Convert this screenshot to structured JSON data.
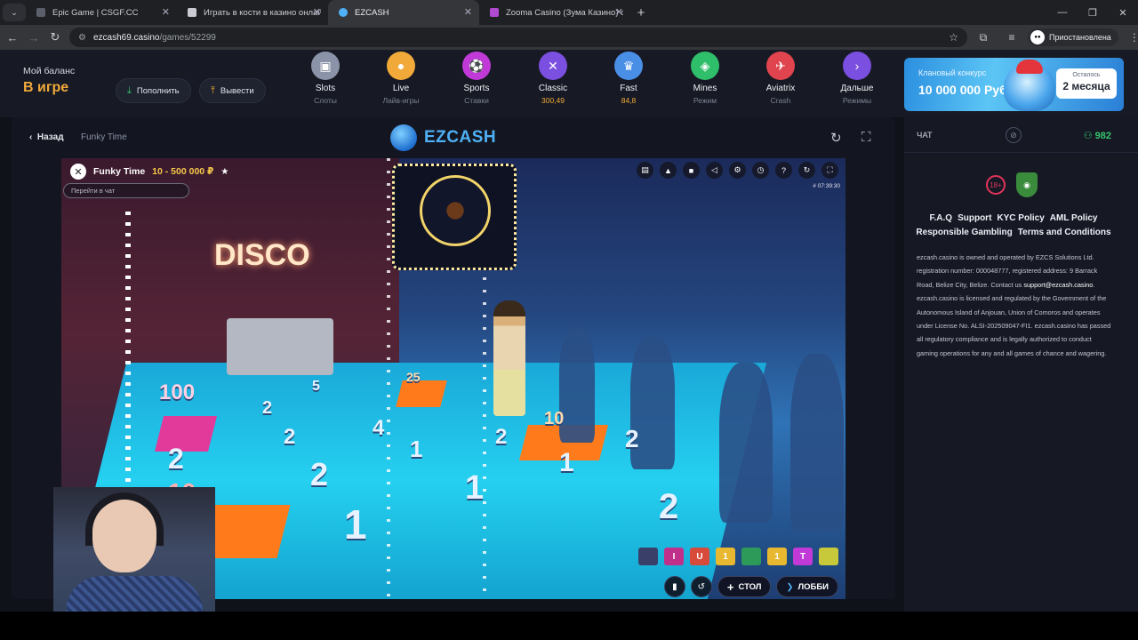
{
  "browser": {
    "tabs": [
      {
        "title": "Epic Game | CSGF.CC",
        "favicon_color": "#5a5f6a",
        "active": false
      },
      {
        "title": "Играть в кости в казино онлайн",
        "favicon_color": "#c9ccd2",
        "active": false
      },
      {
        "title": "EZCASH",
        "favicon_color": "#4fb0f5",
        "active": true
      },
      {
        "title": "Zooma Casino (Зума Казино) о",
        "favicon_color": "#b04ad0",
        "active": false
      }
    ],
    "new_tab": "+",
    "url_host": "ezcash69.casino",
    "url_path": "/games/52299",
    "profile_label": "Приостановлена"
  },
  "header": {
    "balance_title": "Мой баланс",
    "balance_value": "В игре",
    "deposit_label": "Пополнить",
    "withdraw_label": "Вывести",
    "nav": [
      {
        "label": "Slots",
        "sub": "Слоты",
        "color": "#8b93a8",
        "glyph": "▣"
      },
      {
        "label": "Live",
        "sub": "Лайв-игры",
        "color": "#f1a93a",
        "glyph": "●"
      },
      {
        "label": "Sports",
        "sub": "Ставки",
        "color": "#c13ad8",
        "glyph": "⚽"
      },
      {
        "label": "Classic",
        "sub": "300,49",
        "color": "#7b4fe0",
        "glyph": "✕",
        "num": true
      },
      {
        "label": "Fast",
        "sub": "84,8",
        "color": "#4a8fe6",
        "glyph": "♛",
        "num": true
      },
      {
        "label": "Mines",
        "sub": "Режим",
        "color": "#2fbf6a",
        "glyph": "◈"
      },
      {
        "label": "Aviatrix",
        "sub": "Crash",
        "color": "#e0444e",
        "glyph": "✈"
      },
      {
        "label": "Дальше",
        "sub": "Режимы",
        "color": "#7b4fe0",
        "glyph": "›"
      }
    ],
    "promo": {
      "line1": "Клановый конкурс",
      "line2": "10 000 000 Руб",
      "counter_label": "Осталось",
      "counter_value": "2 месяца"
    }
  },
  "game": {
    "back_label": "Назад",
    "name": "Funky Time",
    "logo_text": "EZCASH",
    "video_title": "Funky Time",
    "prize_range": "10 - 500 000 ₽",
    "chat_placeholder": "Перейти в чат",
    "timestamp": "# 07:39:30",
    "table_label": "СТОЛ",
    "lobby_label": "ЛОББИ",
    "segments": [
      {
        "text": "",
        "color": "#3a3f6a"
      },
      {
        "text": "I",
        "color": "#c0308a"
      },
      {
        "text": "U",
        "color": "#d84a3a"
      },
      {
        "text": "1",
        "color": "#e8b830"
      },
      {
        "text": "",
        "color": "#2d9a5a"
      },
      {
        "text": "1",
        "color": "#e8b830"
      },
      {
        "text": "T",
        "color": "#c13ad8"
      },
      {
        "text": "",
        "color": "#c7c83a"
      }
    ],
    "scene_text": {
      "disco": "DISCO",
      "n100": "100",
      "n10a": "10",
      "n10b": "10",
      "n25": "25",
      "n5": "5",
      "n2": "2",
      "n1": "1",
      "n4": "4"
    }
  },
  "sidebar": {
    "chat_label": "ЧАТ",
    "online_count": "982",
    "age_badge": "18+",
    "links_line1": [
      "F.A.Q",
      "Support",
      "KYC Policy",
      "AML Policy"
    ],
    "links_line2": [
      "Responsible Gambling",
      "Terms and Conditions"
    ],
    "legal_1": "ezcash.casino is owned and operated by EZCS Solutions Ltd. registration number: 000048777, registered address: 9 Barrack Road, Belize City, Belize. Contact us ",
    "legal_email": "support@ezcash.casino",
    "legal_2": ". ezcash.casino is licensed and regulated by the Government of the Autonomous Island of Anjouan, Union of Comoros and operates under License No. ALSI-202509047-FI1. ezcash.casino has passed all regulatory compliance and is legally authorized to conduct gaming operations for any and all games of chance and wagering."
  }
}
